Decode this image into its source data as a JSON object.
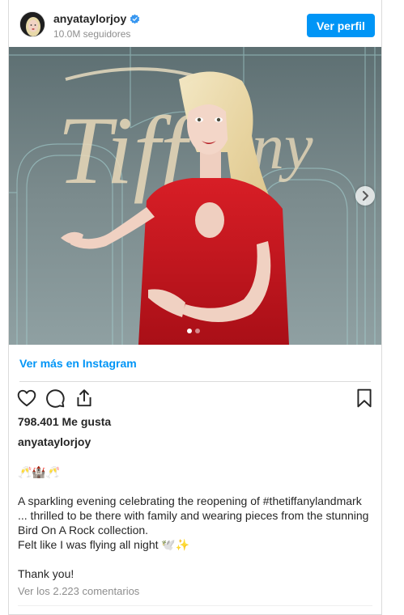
{
  "post": {
    "username": "anyataylorjoy",
    "followers": "10.0M seguidores",
    "view_profile_label": "Ver perfil",
    "view_more_label": "Ver más en Instagram",
    "likes": "798.401 Me gusta",
    "caption_user": "anyataylorjoy",
    "caption_emoji_line": "🥂🏰🥂",
    "caption_line_1": "A sparkling evening celebrating the reopening of #thetiffanylandmark",
    "caption_line_2": "... thrilled to be there with family and wearing pieces from the stunning",
    "caption_line_3": "Bird On A Rock collection.",
    "caption_line_4": "Felt like I was flying all night 🕊️✨",
    "caption_thanks": "Thank you!",
    "view_comments_label": "Ver los 2.223 comentarios",
    "photo_backdrop_text": "Tiffany",
    "carousel_total": 2,
    "carousel_current": 1
  },
  "colors": {
    "accent": "#0095f6",
    "verified": "#3897f0",
    "text": "#262626",
    "muted": "#8e8e8e",
    "dress": "#c8141c"
  },
  "icons": [
    "verified-badge-icon",
    "heart-icon",
    "comment-icon",
    "share-icon",
    "bookmark-icon",
    "chevron-right-icon"
  ]
}
